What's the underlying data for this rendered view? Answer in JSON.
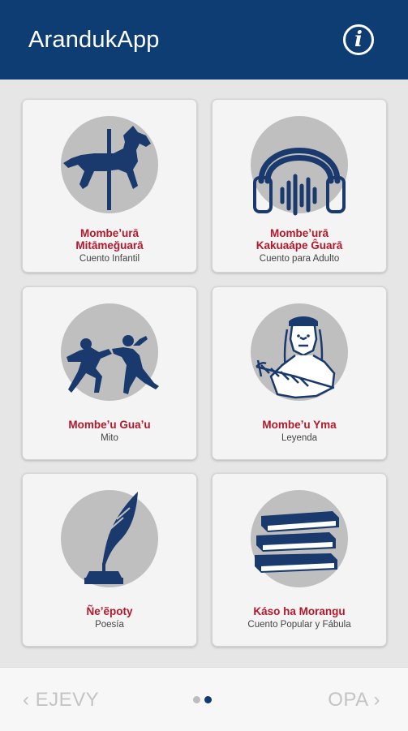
{
  "app": {
    "title": "ArandukApp",
    "info_glyph": "i"
  },
  "colors": {
    "appbar": "#0e3d73",
    "card_title": "#b3182b",
    "icon": "#1a3a6e",
    "icon_circle": "#bfbfbf"
  },
  "cards": [
    {
      "title_line1": "Mombeʼurā",
      "title_line2": "Mitāmeğuarā",
      "subtitle": "Cuento Infantil",
      "icon": "carousel-horse-icon"
    },
    {
      "title_line1": "Mombeʼurā",
      "title_line2": "Kakuaápe Ĝuarā",
      "subtitle": "Cuento para Adulto",
      "icon": "headphones-icon"
    },
    {
      "title": "Mombeʼu Guaʼu",
      "subtitle": "Mito",
      "icon": "running-figures-icon"
    },
    {
      "title": "Mombeʼu Yma",
      "subtitle": "Leyenda",
      "icon": "indigenous-man-icon"
    },
    {
      "title": "Ñeʼẽpoty",
      "subtitle": "Poesía",
      "icon": "quill-inkwell-icon"
    },
    {
      "title": "Káso ha Morangu",
      "subtitle": "Cuento Popular y Fábula",
      "icon": "stacked-books-icon"
    }
  ],
  "nav": {
    "prev_label": "‹ EJEVY",
    "next_label": "OPA ›",
    "pages": 2,
    "current_page": 2
  }
}
